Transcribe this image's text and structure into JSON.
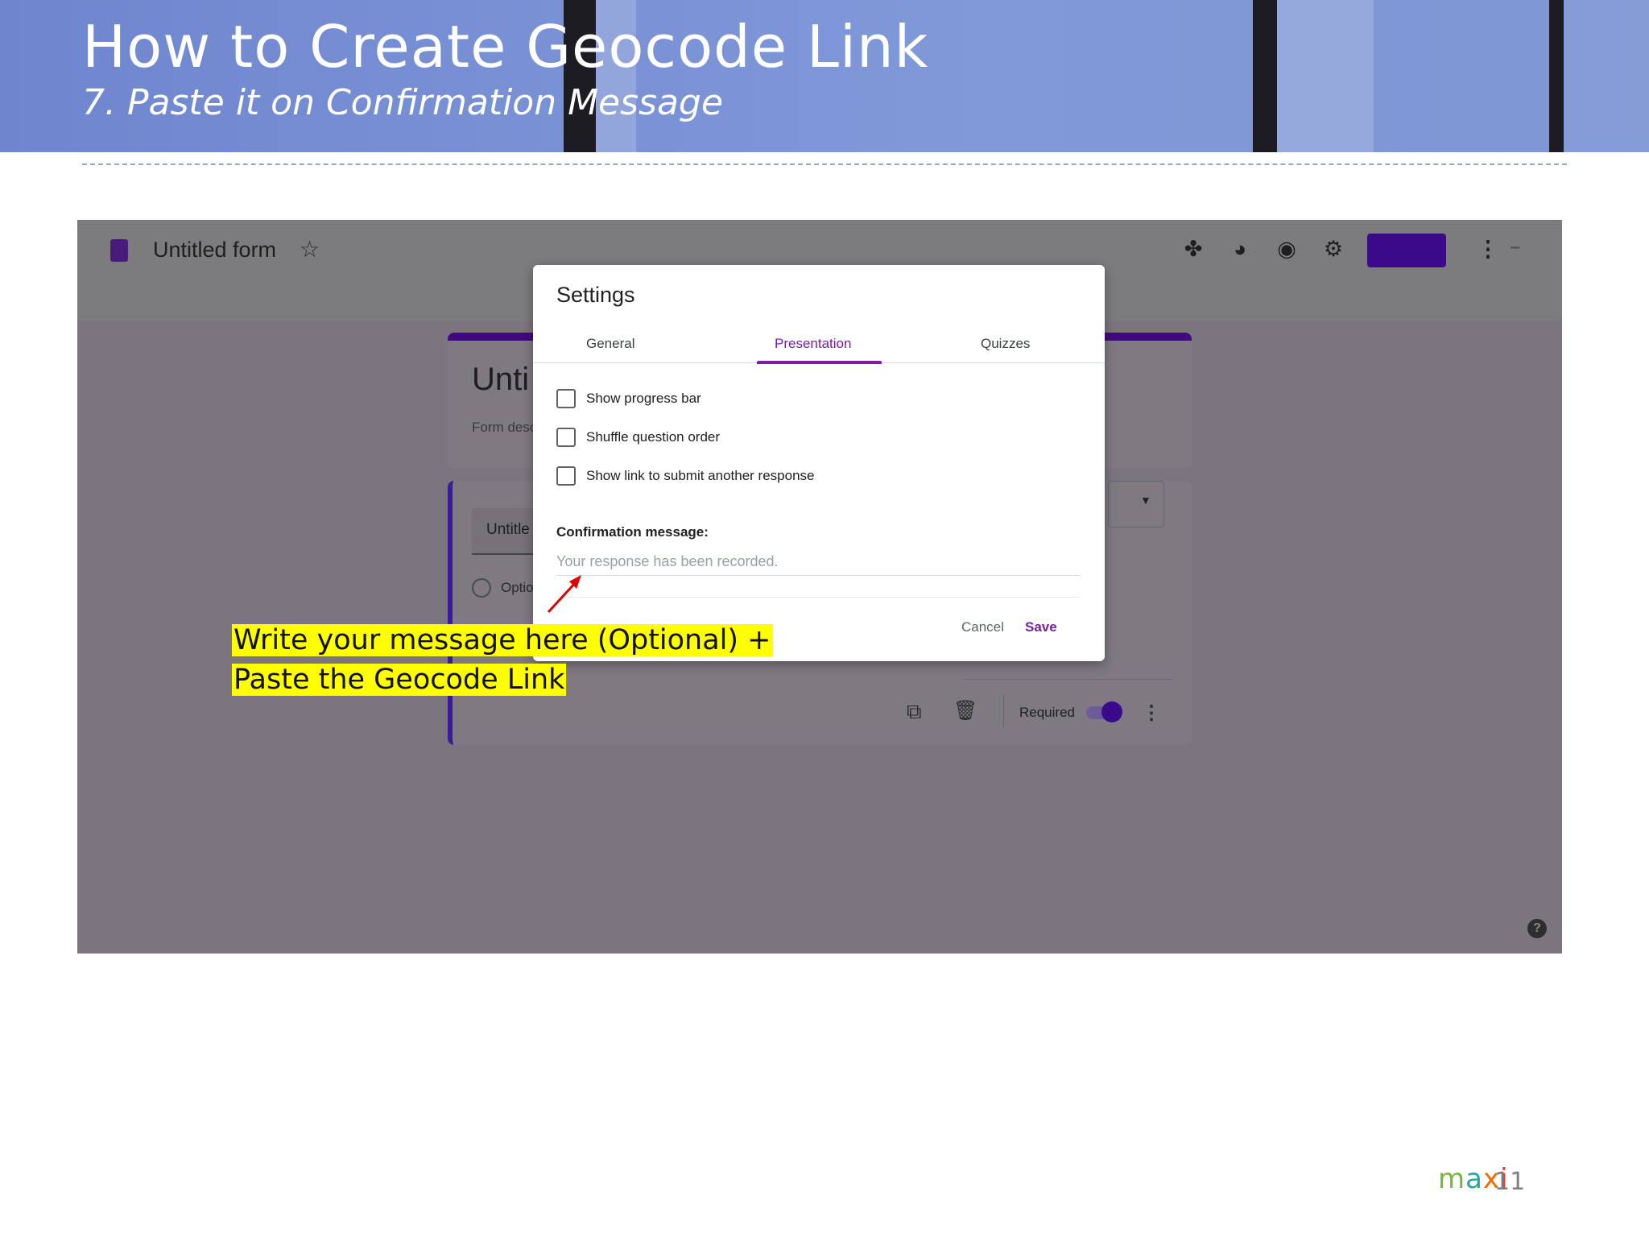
{
  "slide": {
    "title": "How to Create Geocode Link",
    "subtitle": "7. Paste it on Confirmation Message",
    "page_number": "11"
  },
  "brand": {
    "m": "m",
    "a": "a",
    "x": "x",
    "i": "i"
  },
  "forms_app": {
    "form_name": "Untitled form",
    "background_form": {
      "title_partial": "Unti",
      "description_partial": "Form desc",
      "question_partial": "Untitle",
      "option_partial": "Optio",
      "required_label": "Required",
      "required_on": true
    },
    "icons": [
      "forms-doc-icon",
      "star-icon",
      "addon-icon",
      "palette-icon",
      "eye-icon",
      "gear-icon",
      "more-icon",
      "copy-icon",
      "trash-icon",
      "help-icon"
    ]
  },
  "settings_dialog": {
    "title": "Settings",
    "tabs": [
      {
        "label": "General",
        "active": false
      },
      {
        "label": "Presentation",
        "active": true
      },
      {
        "label": "Quizzes",
        "active": false
      }
    ],
    "options": [
      {
        "label": "Show progress bar",
        "checked": false
      },
      {
        "label": "Shuffle question order",
        "checked": false
      },
      {
        "label": "Show link to submit another response",
        "checked": false
      }
    ],
    "confirmation": {
      "label": "Confirmation message:",
      "value": "",
      "placeholder": "Your response has been recorded."
    },
    "cancel_label": "Cancel",
    "save_label": "Save"
  },
  "annotation": {
    "line1": "Write your message here (Optional) +",
    "line2": "Paste the Geocode Link"
  },
  "colors": {
    "accent": "#7b1fa2",
    "highlight": "#ffff00",
    "arrow": "#e00000"
  }
}
